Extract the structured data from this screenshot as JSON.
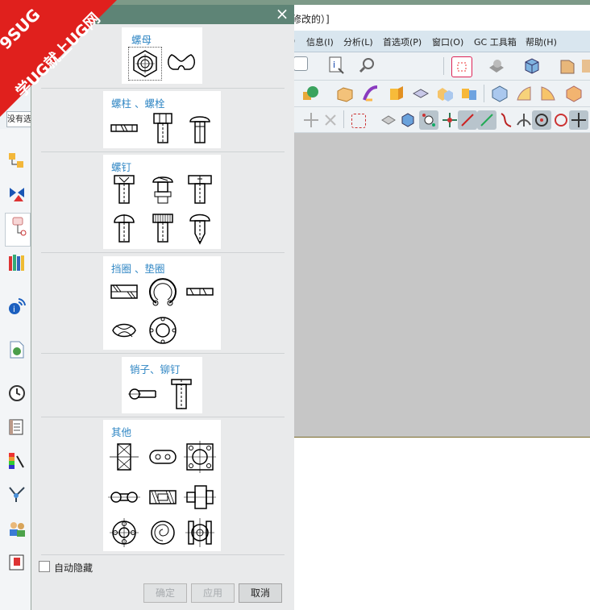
{
  "app": {
    "title_fragment": "修改的）]"
  },
  "menu": [
    {
      "label": ")"
    },
    {
      "label": "信息(I)"
    },
    {
      "label": "分析(L)"
    },
    {
      "label": "首选项(P)"
    },
    {
      "label": "窗口(O)"
    },
    {
      "label": "GC 工具箱"
    },
    {
      "label": "帮助(H)"
    }
  ],
  "left_field": {
    "value": "没有选"
  },
  "dialog": {
    "close_symbol": "×",
    "groups": [
      {
        "title": "螺母",
        "icons": [
          "hex-nut-icon",
          "wing-nut-icon"
        ]
      },
      {
        "title": "螺柱 、螺栓",
        "icons": [
          "stud-icon",
          "hex-bolt-icon",
          "carriage-bolt-icon"
        ]
      },
      {
        "title": "螺钉",
        "icons": [
          "socket-screw-icon",
          "set-screw-icon",
          "slotted-screw-icon",
          "round-head-screw-icon",
          "knurled-screw-icon",
          "wood-screw-icon"
        ]
      },
      {
        "title": "挡圈 、垫圈",
        "icons": [
          "retaining-ring-icon",
          "circlip-icon",
          "flat-washer-icon",
          "spring-washer-icon",
          "lock-washer-icon"
        ]
      },
      {
        "title": "销子、铆钉",
        "icons": [
          "cotter-pin-icon",
          "rivet-icon"
        ]
      },
      {
        "title": "其他",
        "icons": [
          "block-icon",
          "slot-plate-icon",
          "flange-icon",
          "link-icon",
          "bushing-icon",
          "coupling-icon",
          "bearing-icon",
          "spiral-icon",
          "double-bearing-icon"
        ]
      }
    ],
    "autohide_label": "自动隐藏",
    "buttons": {
      "ok": "确定",
      "apply": "应用",
      "cancel": "取消"
    }
  },
  "watermark": {
    "line1": "9SUG",
    "line2": "学UG就上UG网"
  },
  "colors": {
    "dialog_header": "#5e8476",
    "group_title": "#2f86c4",
    "menubar": "#d9e6ef",
    "viewport": "#c6c6c6",
    "watermark": "#e0201d"
  }
}
